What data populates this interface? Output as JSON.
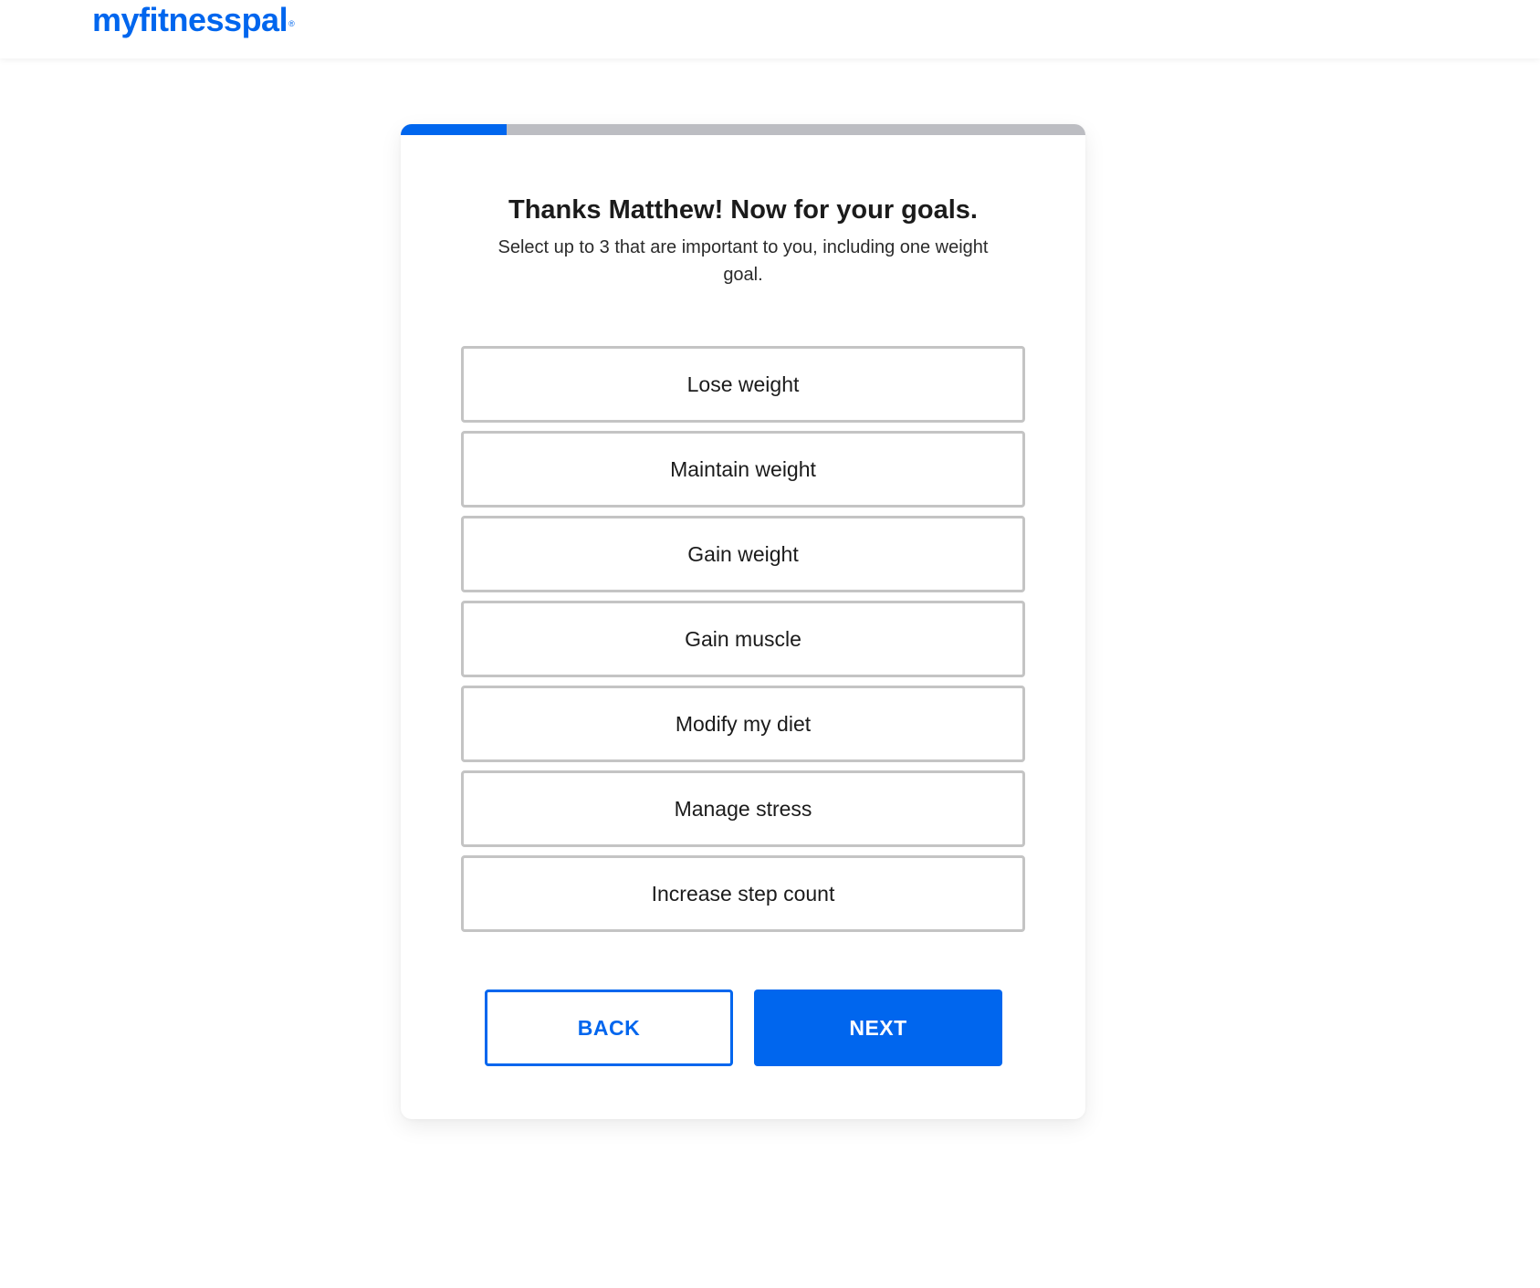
{
  "header": {
    "logo_text": "myfitnesspal",
    "logo_mark": "®"
  },
  "progress": {
    "fraction": 0.155
  },
  "goals": {
    "title": "Thanks Matthew! Now for your goals.",
    "subtitle": "Select up to 3 that are important to you, including one weight goal.",
    "options": [
      "Lose weight",
      "Maintain weight",
      "Gain weight",
      "Gain muscle",
      "Modify my diet",
      "Manage stress",
      "Increase step count"
    ]
  },
  "actions": {
    "back_label": "BACK",
    "next_label": "NEXT"
  },
  "colors": {
    "brand": "#0066ee",
    "progress_track": "#bcbdc2",
    "option_border": "#c4c4c4"
  }
}
